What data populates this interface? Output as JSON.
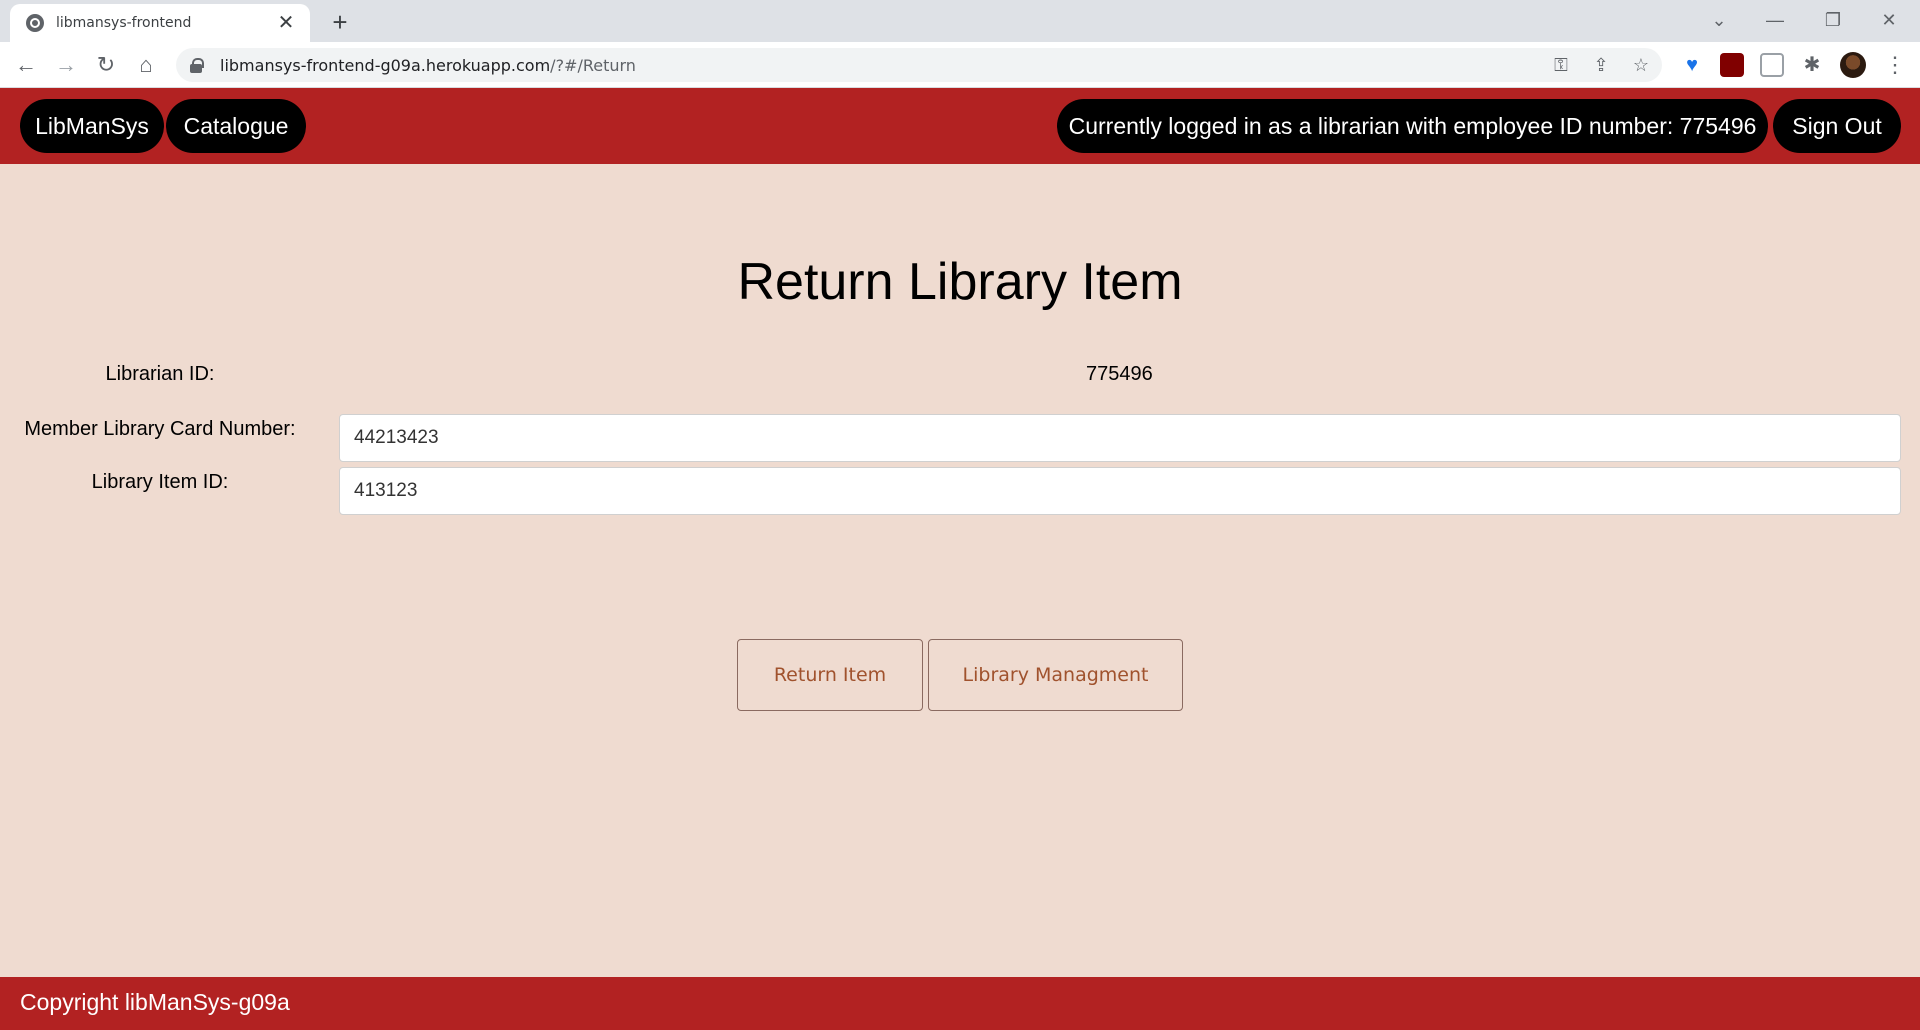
{
  "browser": {
    "tab_title": "libmansys-frontend",
    "tab_close": "✕",
    "new_tab": "+",
    "url_host": "libmansys-frontend-g09a.herokuapp.com",
    "url_path": "/?#/Return"
  },
  "header": {
    "brand": "LibManSys",
    "catalogue": "Catalogue",
    "login_status": "Currently logged in as a librarian with employee ID number: 775496",
    "sign_out": "Sign Out"
  },
  "form": {
    "title": "Return Library Item",
    "librarian_id_label": "Librarian ID:",
    "librarian_id_value": "775496",
    "card_number_label": "Member Library Card Number:",
    "card_number_value": "44213423",
    "item_id_label": "Library Item ID:",
    "item_id_value": "413123",
    "return_button": "Return Item",
    "management_button": "Library Managment"
  },
  "footer": {
    "copyright": "Copyright libManSys-g09a"
  },
  "colors": {
    "header_bg": "#b22222",
    "page_bg": "#efdbd0",
    "pill_bg": "#000000",
    "button_text": "#a0522d"
  }
}
